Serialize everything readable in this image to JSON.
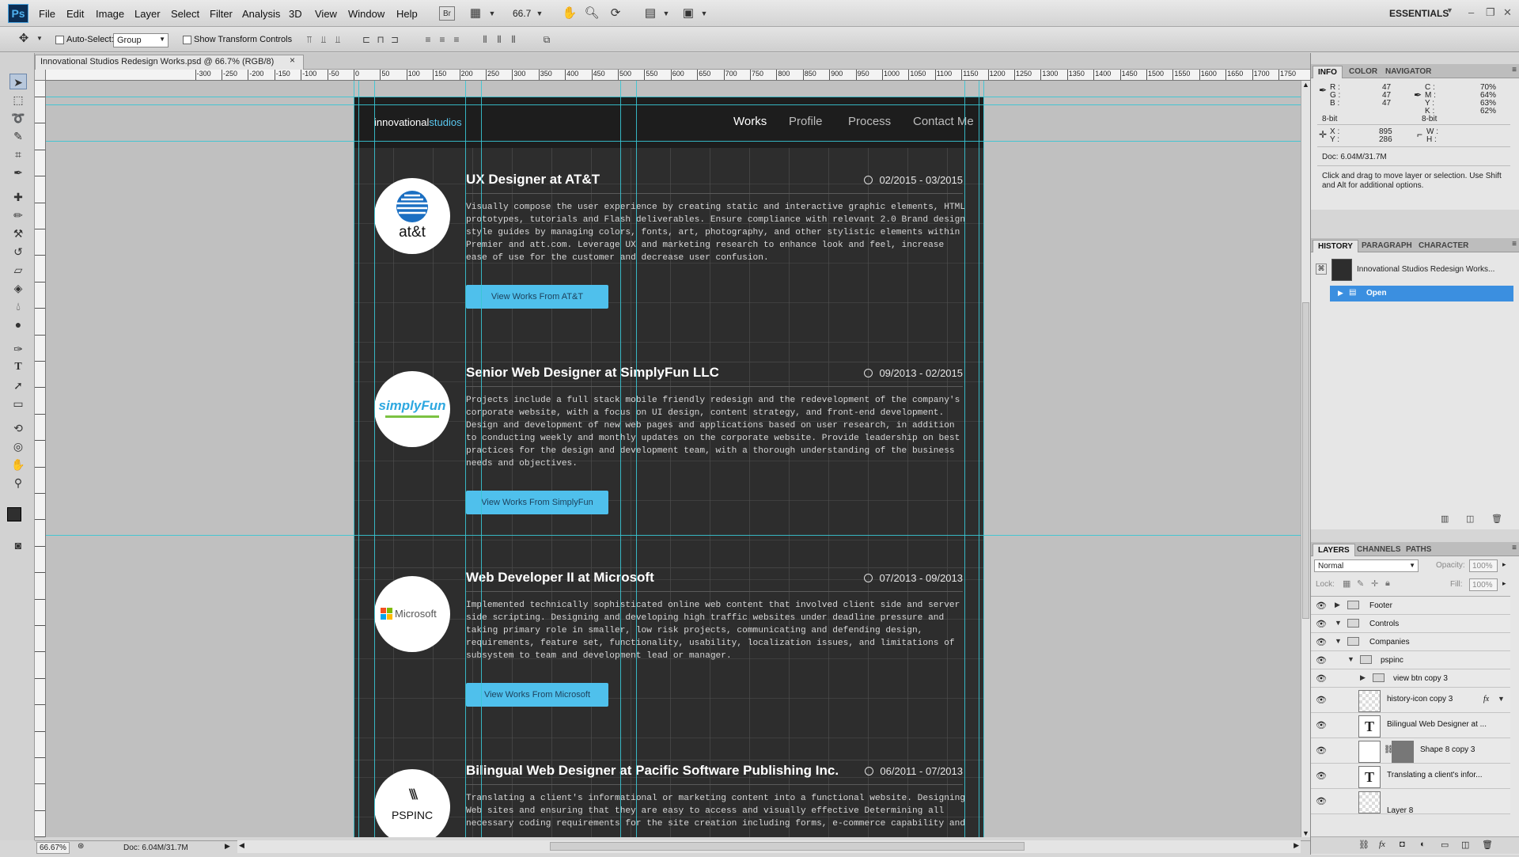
{
  "app": {
    "logo": "Ps",
    "menu": [
      "File",
      "Edit",
      "Image",
      "Layer",
      "Select",
      "Filter",
      "Analysis",
      "3D",
      "View",
      "Window",
      "Help"
    ],
    "zoom_value": "66.7",
    "workspace": "ESSENTIALS"
  },
  "options": {
    "auto_select_label": "Auto-Select:",
    "auto_select_value": "Group",
    "transform_label": "Show Transform Controls"
  },
  "document": {
    "tab_title": "Innovational Studios Redesign Works.psd @ 66.7% (RGB/8)",
    "close": "×"
  },
  "rulers": {
    "h_labels": [
      "-300",
      "-250",
      "-200",
      "-150",
      "-100",
      "-50",
      "0",
      "50",
      "100",
      "150",
      "200",
      "250",
      "300",
      "350",
      "400",
      "450",
      "500",
      "550",
      "600",
      "650",
      "700",
      "750",
      "800",
      "850",
      "900",
      "950",
      "1000",
      "1050",
      "1100",
      "1150",
      "1200",
      "1250",
      "1300",
      "1350",
      "1400",
      "1450",
      "1500",
      "1550",
      "1600",
      "1650",
      "1700",
      "1750"
    ]
  },
  "site": {
    "logo_main": "innovational",
    "logo_accent": "studios",
    "nav": [
      "Works",
      "Profile",
      "Process",
      "Contact Me"
    ],
    "entries": [
      {
        "title": "UX Designer at AT&T",
        "date": "02/2015 - 03/2015",
        "logo_text": "at&t",
        "description": "Visually compose the user experience by creating static and interactive graphic elements, HTML prototypes, tutorials and Flash deliverables. Ensure compliance with relevant 2.0 Brand design style guides by managing colors, fonts, art, photography, and other stylistic elements within Premier and att.com. Leverage UX and marketing research to enhance look and feel, increase ease of use for the customer and decrease user confusion.",
        "button": "View Works From AT&T"
      },
      {
        "title": "Senior Web Designer at SimplyFun LLC",
        "date": "09/2013 - 02/2015",
        "logo_text": "simplyFun",
        "description": "Projects include a full stack mobile friendly redesign and the redevelopment of the company's corporate website, with a focus on UI design, content strategy, and front-end development. Design and development of new web pages and applications based on user research, in addition to conducting weekly and monthly updates on the corporate website. Provide leadership on best practices for the design and development team, with a thorough understanding of the business needs and objectives.",
        "button": "View Works From SimplyFun"
      },
      {
        "title": "Web Developer II at Microsoft",
        "date": "07/2013 - 09/2013",
        "logo_text": "Microsoft",
        "description": "Implemented technically sophisticated online web content that involved client side and server side scripting. Designing and developing high traffic websites under deadline pressure and taking primary role in smaller, low risk projects, communicating and defending design, requirements, feature set, functionality, usability, localization issues, and limitations of subsystem to team and development lead or manager.",
        "button": "View Works From Microsoft"
      },
      {
        "title": "Bilingual Web Designer at Pacific Software Publishing Inc.",
        "date": "06/2011 - 07/2013",
        "logo_text": "PSPINC",
        "description": "Translating a client's informational or marketing content into a functional website. Designing Web sites and ensuring that they are easy to access and visually effective Determining all necessary coding requirements for the site creation including forms, e-commerce capability and",
        "button": ""
      }
    ]
  },
  "status": {
    "zoom": "66.67%",
    "doc": "Doc: 6.04M/31.7M"
  },
  "panels": {
    "info_tabs": [
      "INFO",
      "COLOR",
      "NAVIGATOR"
    ],
    "info": {
      "r": "R :",
      "g": "G :",
      "b": "B :",
      "r_val": "47",
      "g_val": "47",
      "b_val": "47",
      "c": "C :",
      "m": "M :",
      "y": "Y :",
      "k": "K :",
      "c_val": "70%",
      "m_val": "64%",
      "y_val": "63%",
      "k_val": "62%",
      "bit_left": "8-bit",
      "bit_right": "8-bit",
      "x": "X :",
      "y_coord": "Y :",
      "x_val": "895",
      "y_val_coord": "286",
      "w": "W :",
      "h": "H :",
      "doc": "Doc: 6.04M/31.7M",
      "hint": "Click and drag to move layer or selection.  Use Shift and Alt for additional options."
    },
    "history_tabs": [
      "HISTORY",
      "PARAGRAPH",
      "CHARACTER"
    ],
    "history": {
      "snapshot": "Innovational Studios Redesign Works...",
      "state": "Open"
    },
    "layers_tabs": [
      "LAYERS",
      "CHANNELS",
      "PATHS"
    ],
    "blend_mode": "Normal",
    "opacity_label": "Opacity:",
    "opacity": "100%",
    "lock_label": "Lock:",
    "fill_label": "Fill:",
    "fill": "100%",
    "layers": [
      {
        "name": "Footer",
        "kind": "folder",
        "indent": 0,
        "open": false
      },
      {
        "name": "Controls",
        "kind": "folder",
        "indent": 0,
        "open": true
      },
      {
        "name": "Companies",
        "kind": "folder",
        "indent": 0,
        "open": true
      },
      {
        "name": "pspinc",
        "kind": "folder",
        "indent": 1,
        "open": true
      },
      {
        "name": "view btn copy 3",
        "kind": "folder",
        "indent": 2,
        "open": false
      },
      {
        "name": "history-icon copy 3",
        "kind": "raster",
        "indent": 2
      },
      {
        "name": "Bilingual Web Designer at ...",
        "kind": "text",
        "indent": 2
      },
      {
        "name": "Shape 8 copy 3",
        "kind": "shape",
        "indent": 2
      },
      {
        "name": "Translating a client's infor...",
        "kind": "text",
        "indent": 2
      },
      {
        "name": "Layer 8",
        "kind": "raster",
        "indent": 2
      }
    ],
    "fx_label": "fx"
  },
  "colors": {
    "accent": "#4fc0ec",
    "artboard_bg": "#2d2d2d",
    "guide": "#39c5d4",
    "selection": "#3b8fe0"
  }
}
